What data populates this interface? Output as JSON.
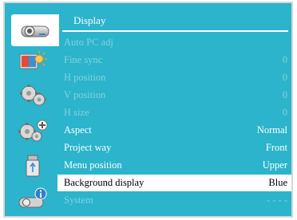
{
  "menu": {
    "title": "Display",
    "items": [
      {
        "label": "Auto PC adj",
        "value": "",
        "disabled": true
      },
      {
        "label": "Fine sync",
        "value": "0",
        "disabled": true
      },
      {
        "label": "H position",
        "value": "0",
        "disabled": true
      },
      {
        "label": "V position",
        "value": "0",
        "disabled": true
      },
      {
        "label": "H size",
        "value": "0",
        "disabled": true
      },
      {
        "label": "Aspect",
        "value": "Normal",
        "disabled": false
      },
      {
        "label": "Project way",
        "value": "Front",
        "disabled": false
      },
      {
        "label": "Menu position",
        "value": "Upper",
        "disabled": false
      },
      {
        "label": "Background display",
        "value": "Blue",
        "disabled": false,
        "selected": true
      },
      {
        "label": "System",
        "value": "- - - -",
        "disabled": true
      }
    ]
  },
  "sidebar": {
    "icons": [
      {
        "name": "display-icon",
        "selected": true
      },
      {
        "name": "color-adjust-icon",
        "selected": false
      },
      {
        "name": "setting-gear-icon",
        "selected": false
      },
      {
        "name": "expanded-setting-gear-icon",
        "selected": false
      },
      {
        "name": "memory-viewer-icon",
        "selected": false
      },
      {
        "name": "info-icon",
        "selected": false
      }
    ]
  },
  "colors": {
    "background": "#2bb4cc",
    "selected_row": "#ffffff",
    "disabled_text": "#84d3e0"
  }
}
